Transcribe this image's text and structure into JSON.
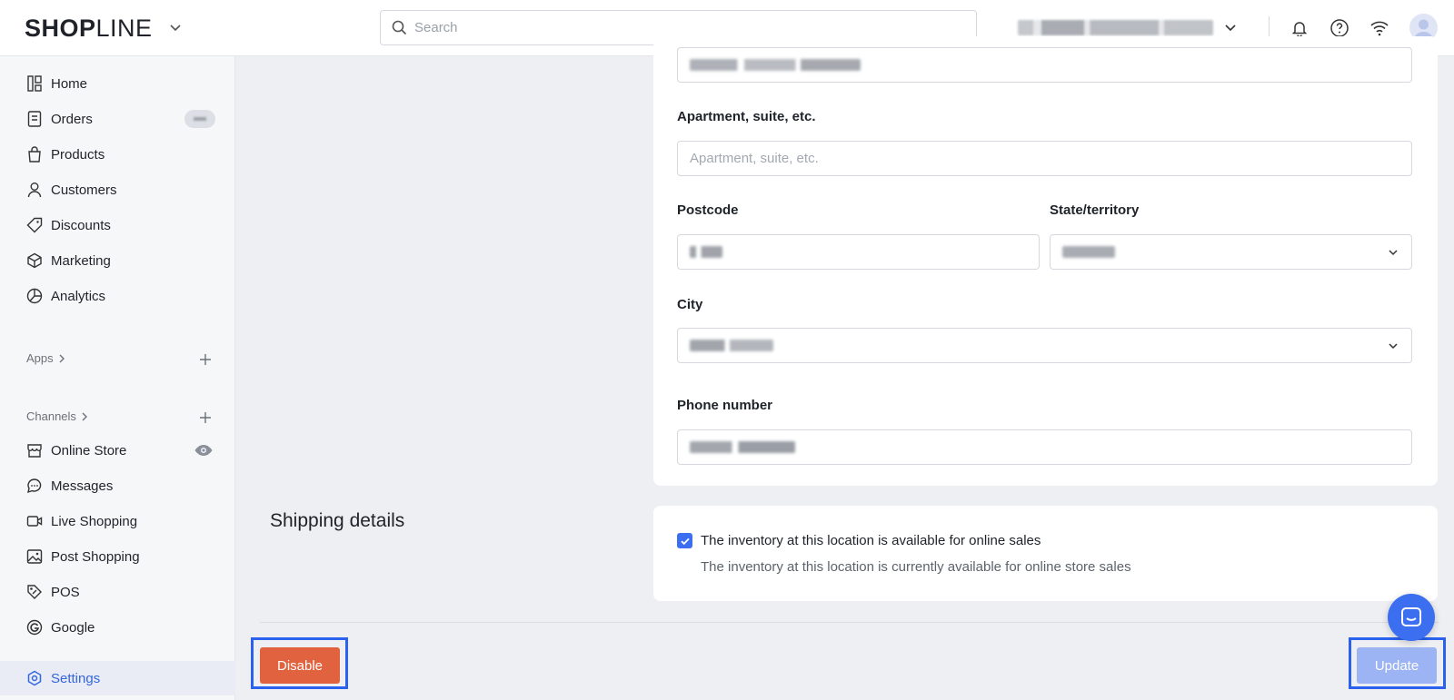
{
  "brand": {
    "logo_bold": "SHOP",
    "logo_light": "LINE"
  },
  "search": {
    "placeholder": "Search"
  },
  "sidebar": {
    "items": [
      {
        "label": "Home",
        "icon": "home-icon"
      },
      {
        "label": "Orders",
        "icon": "orders-icon"
      },
      {
        "label": "Products",
        "icon": "bag-icon"
      },
      {
        "label": "Customers",
        "icon": "user-icon"
      },
      {
        "label": "Discounts",
        "icon": "tag-icon"
      },
      {
        "label": "Marketing",
        "icon": "cube-icon"
      },
      {
        "label": "Analytics",
        "icon": "pie-icon"
      }
    ],
    "apps_label": "Apps",
    "channels_label": "Channels",
    "channels": [
      {
        "label": "Online Store",
        "icon": "store-icon"
      },
      {
        "label": "Messages",
        "icon": "chat-icon"
      },
      {
        "label": "Live Shopping",
        "icon": "video-icon"
      },
      {
        "label": "Post Shopping",
        "icon": "image-icon"
      },
      {
        "label": "POS",
        "icon": "pos-tag-icon"
      },
      {
        "label": "Google",
        "icon": "google-icon"
      }
    ],
    "settings_label": "Settings"
  },
  "form": {
    "apartment_label": "Apartment, suite, etc.",
    "apartment_placeholder": "Apartment, suite, etc.",
    "postcode_label": "Postcode",
    "state_label": "State/territory",
    "city_label": "City",
    "phone_label": "Phone number"
  },
  "shipping": {
    "title": "Shipping details",
    "checkbox_label": "The inventory at this location is available for online sales",
    "checkbox_help": "The inventory at this location is currently available for online store sales",
    "checked": true
  },
  "actions": {
    "disable_label": "Disable",
    "update_label": "Update"
  },
  "colors": {
    "accent": "#3b6ff0",
    "danger": "#e0623f",
    "highlight": "#2a61ef"
  }
}
